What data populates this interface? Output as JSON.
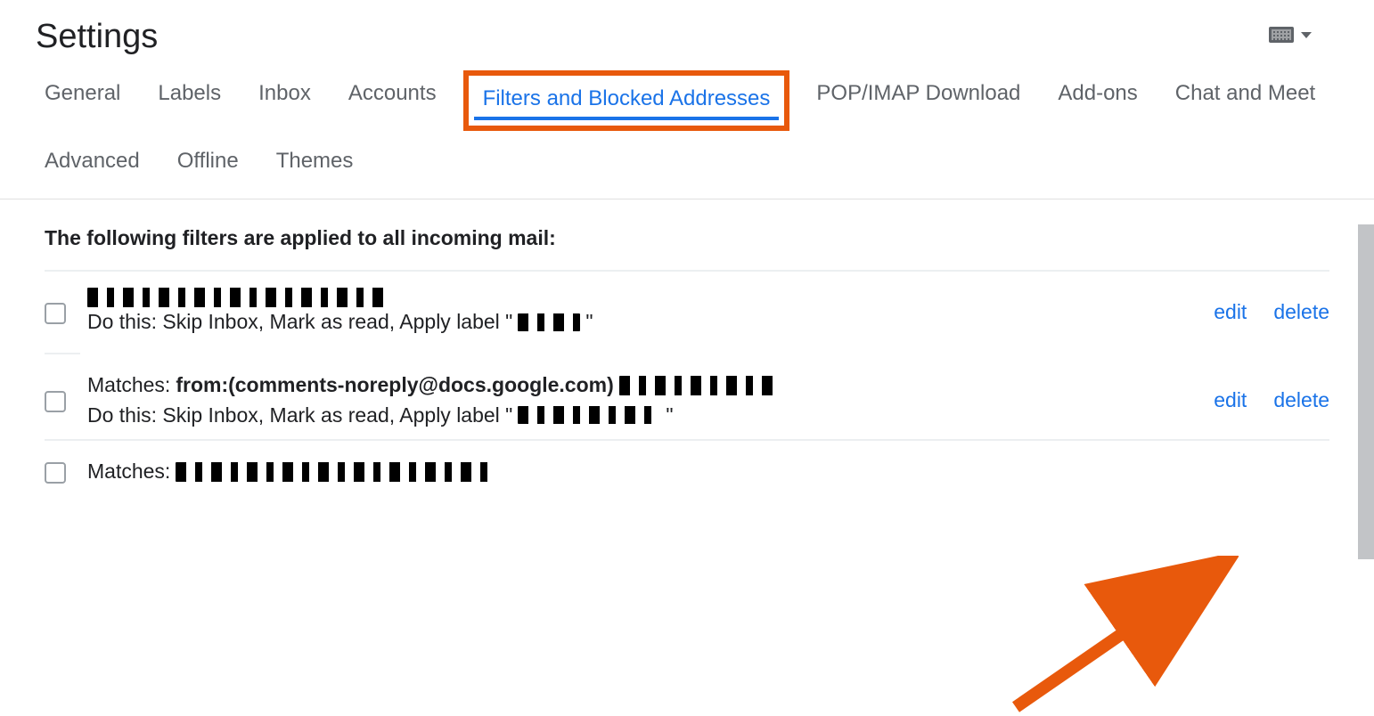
{
  "page_title": "Settings",
  "tabs": {
    "general": "General",
    "labels": "Labels",
    "inbox": "Inbox",
    "accounts": "Accounts",
    "filters": "Filters and Blocked Addresses",
    "popimap": "POP/IMAP Download",
    "addons": "Add-ons",
    "chatmeet": "Chat and Meet",
    "advanced": "Advanced",
    "offline": "Offline",
    "themes": "Themes"
  },
  "intro": "The following filters are applied to all incoming mail:",
  "filters": [
    {
      "matches_prefix": "",
      "matches_bold": "",
      "do_prefix": "Do this: Skip Inbox, Mark as read, Apply label \"",
      "do_suffix": "\"",
      "edit": "edit",
      "delete": "delete"
    },
    {
      "matches_prefix": "Matches: ",
      "matches_bold": "from:(comments-noreply@docs.google.com)",
      "do_prefix": "Do this: Skip Inbox, Mark as read, Apply label \"",
      "do_suffix": "\"",
      "edit": "edit",
      "delete": "delete"
    },
    {
      "matches_prefix": "Matches:",
      "matches_bold": "",
      "do_prefix": "",
      "do_suffix": "",
      "edit": "",
      "delete": ""
    }
  ]
}
